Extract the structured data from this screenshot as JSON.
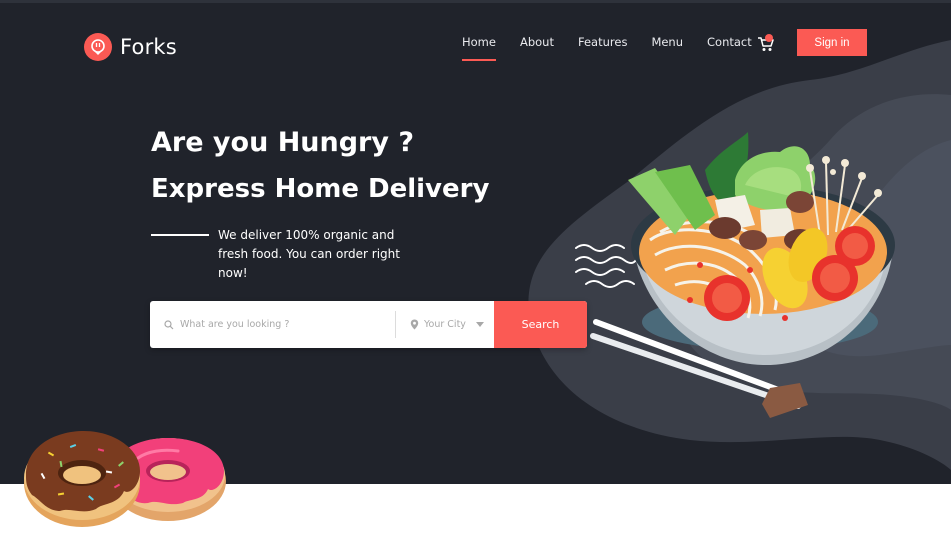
{
  "header": {
    "logo_text": "Forks",
    "nav": [
      {
        "label": "Home",
        "active": true
      },
      {
        "label": "About",
        "active": false
      },
      {
        "label": "Features",
        "active": false
      },
      {
        "label": "Menu",
        "active": false
      },
      {
        "label": "Contact",
        "active": false
      }
    ],
    "signin_label": "Sign in",
    "cart_icon": "cart-icon"
  },
  "hero": {
    "headline": "Are you Hungry ?",
    "subheadline": "Express Home Delivery",
    "tagline": "We deliver 100% organic  and fresh food. You can order right now!"
  },
  "search": {
    "placeholder": "What are you looking ?",
    "city_placeholder": "Your City",
    "button_label": "Search"
  },
  "colors": {
    "accent": "#fb5a54",
    "hero_bg": "#20232b",
    "blob": "#3a3e48"
  }
}
